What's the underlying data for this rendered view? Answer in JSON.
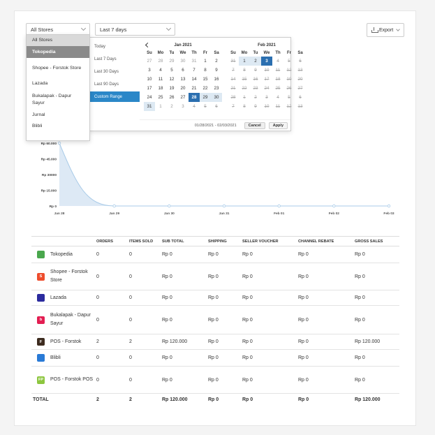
{
  "filters": {
    "store_select": "All Stores",
    "period_select": "Last 7 days",
    "export_label": "Export"
  },
  "store_dropdown": {
    "options": [
      "All Stores",
      "Tokopedia",
      "Shopee - Forstok Store",
      "Lazada",
      "Bukalapak - Dapur Sayur",
      "Jurnal",
      "Blibli"
    ],
    "selected": "Tokopedia"
  },
  "date_picker": {
    "ranges": [
      "Today",
      "Last 7 Days",
      "Last 30 Days",
      "Last 90 Days",
      "Custom Range"
    ],
    "active_range": "Custom Range",
    "weekdays": [
      "Su",
      "Mo",
      "Tu",
      "We",
      "Th",
      "Fr",
      "Sa"
    ],
    "left_month": {
      "title": "Jan 2021",
      "days": [
        [
          "27",
          "off"
        ],
        [
          "28",
          "off"
        ],
        [
          "29",
          "off"
        ],
        [
          "30",
          "off"
        ],
        [
          "31",
          "off"
        ],
        [
          "1",
          ""
        ],
        [
          "2",
          ""
        ],
        [
          "3",
          ""
        ],
        [
          "4",
          ""
        ],
        [
          "5",
          ""
        ],
        [
          "6",
          ""
        ],
        [
          "7",
          ""
        ],
        [
          "8",
          ""
        ],
        [
          "9",
          ""
        ],
        [
          "10",
          ""
        ],
        [
          "11",
          ""
        ],
        [
          "12",
          ""
        ],
        [
          "13",
          ""
        ],
        [
          "14",
          ""
        ],
        [
          "15",
          ""
        ],
        [
          "16",
          ""
        ],
        [
          "17",
          ""
        ],
        [
          "18",
          ""
        ],
        [
          "19",
          ""
        ],
        [
          "20",
          ""
        ],
        [
          "21",
          ""
        ],
        [
          "22",
          ""
        ],
        [
          "23",
          ""
        ],
        [
          "24",
          ""
        ],
        [
          "25",
          ""
        ],
        [
          "26",
          ""
        ],
        [
          "27",
          ""
        ],
        [
          "28",
          "edge"
        ],
        [
          "29",
          "inr"
        ],
        [
          "30",
          "inr"
        ],
        [
          "31",
          "inr"
        ],
        [
          "1",
          "off"
        ],
        [
          "2",
          "off"
        ],
        [
          "3",
          "off"
        ],
        [
          "4",
          "off dis"
        ],
        [
          "5",
          "off dis"
        ],
        [
          "6",
          "off dis"
        ]
      ]
    },
    "right_month": {
      "title": "Feb 2021",
      "days": [
        [
          "31",
          "dis"
        ],
        [
          "1",
          "inr"
        ],
        [
          "2",
          "inr"
        ],
        [
          "3",
          "edge"
        ],
        [
          "4",
          "dis"
        ],
        [
          "5",
          "dis"
        ],
        [
          "6",
          "dis"
        ],
        [
          "7",
          "dis"
        ],
        [
          "8",
          "dis"
        ],
        [
          "9",
          "dis"
        ],
        [
          "10",
          "dis"
        ],
        [
          "11",
          "dis"
        ],
        [
          "12",
          "dis"
        ],
        [
          "13",
          "dis"
        ],
        [
          "14",
          "dis"
        ],
        [
          "15",
          "dis"
        ],
        [
          "16",
          "dis"
        ],
        [
          "17",
          "dis"
        ],
        [
          "18",
          "dis"
        ],
        [
          "19",
          "dis"
        ],
        [
          "20",
          "dis"
        ],
        [
          "21",
          "dis"
        ],
        [
          "22",
          "dis"
        ],
        [
          "23",
          "dis"
        ],
        [
          "24",
          "dis"
        ],
        [
          "25",
          "dis"
        ],
        [
          "26",
          "dis"
        ],
        [
          "27",
          "dis"
        ],
        [
          "28",
          "dis"
        ],
        [
          "1",
          "dis"
        ],
        [
          "2",
          "dis"
        ],
        [
          "3",
          "dis"
        ],
        [
          "4",
          "dis"
        ],
        [
          "5",
          "dis"
        ],
        [
          "6",
          "dis"
        ],
        [
          "7",
          "dis"
        ],
        [
          "8",
          "dis"
        ],
        [
          "9",
          "dis"
        ],
        [
          "10",
          "dis"
        ],
        [
          "11",
          "dis"
        ],
        [
          "12",
          "dis"
        ],
        [
          "13",
          "dis"
        ]
      ]
    },
    "range_text": "01/28/2021 - 02/03/2021",
    "cancel_label": "Cancel",
    "apply_label": "Apply"
  },
  "chart_data": {
    "type": "area",
    "x": [
      "Jan 28",
      "Jan 29",
      "Jan 30",
      "Jan 31",
      "Feb 01",
      "Feb 02",
      "Feb 03"
    ],
    "series": [
      {
        "values": [
          120000,
          0,
          0,
          0,
          0,
          0,
          0
        ]
      }
    ],
    "y_ticks": [
      "Rp 60.000",
      "Rp 45.000",
      "Rp 30000",
      "Rp 15.000",
      "Rp 0"
    ],
    "ylim": [
      0,
      60000
    ],
    "color": "#a9cbe8",
    "fill": "#dde9f5"
  },
  "table": {
    "columns": [
      "",
      "ORDERS",
      "ITEMS SOLD",
      "SUB TOTAL",
      "SHIPPING",
      "SELLER VOUCHER",
      "CHANNEL REBATE",
      "GROSS SALES"
    ],
    "rows": [
      {
        "store": "Tokopedia",
        "icon": "tokopedia-icon",
        "color": "#4aa74d",
        "glyph": "",
        "cells": [
          "0",
          "0",
          "Rp 0",
          "Rp 0",
          "Rp 0",
          "Rp 0",
          "Rp 0"
        ]
      },
      {
        "store": "Shopee - Forstok Store",
        "icon": "shopee-icon",
        "color": "#ee4d2d",
        "glyph": "S",
        "cells": [
          "0",
          "0",
          "Rp 0",
          "Rp 0",
          "Rp 0",
          "Rp 0",
          "Rp 0"
        ]
      },
      {
        "store": "Lazada",
        "icon": "lazada-icon",
        "color": "#2b2b9e",
        "glyph": "",
        "cells": [
          "0",
          "0",
          "Rp 0",
          "Rp 0",
          "Rp 0",
          "Rp 0",
          "Rp 0"
        ]
      },
      {
        "store": "Bukalapak - Dapur Sayur",
        "icon": "bukalapak-icon",
        "color": "#e31e52",
        "glyph": "b",
        "cells": [
          "0",
          "0",
          "Rp 0",
          "Rp 0",
          "Rp 0",
          "Rp 0",
          "Rp 0"
        ]
      },
      {
        "store": "POS - Forstok",
        "icon": "pos-forstok-icon",
        "color": "#3d2b1f",
        "glyph": "F",
        "cells": [
          "2",
          "2",
          "Rp 120.000",
          "Rp 0",
          "Rp 0",
          "Rp 0",
          "Rp 120.000"
        ]
      },
      {
        "store": "Blibli",
        "icon": "blibli-icon",
        "color": "#2a7ad6",
        "glyph": "",
        "cells": [
          "0",
          "0",
          "Rp 0",
          "Rp 0",
          "Rp 0",
          "Rp 0",
          "Rp 0"
        ]
      },
      {
        "store": "POS - Forstok POS",
        "icon": "pos-forstok-pos-icon",
        "color": "#8dc63f",
        "glyph": "FP",
        "cells": [
          "0",
          "0",
          "Rp 0",
          "Rp 0",
          "Rp 0",
          "Rp 0",
          "Rp 0"
        ]
      }
    ],
    "total": {
      "label": "TOTAL",
      "cells": [
        "2",
        "2",
        "Rp  120.000",
        "Rp  0",
        "Rp  0",
        "Rp  0",
        "Rp  120.000"
      ]
    }
  }
}
